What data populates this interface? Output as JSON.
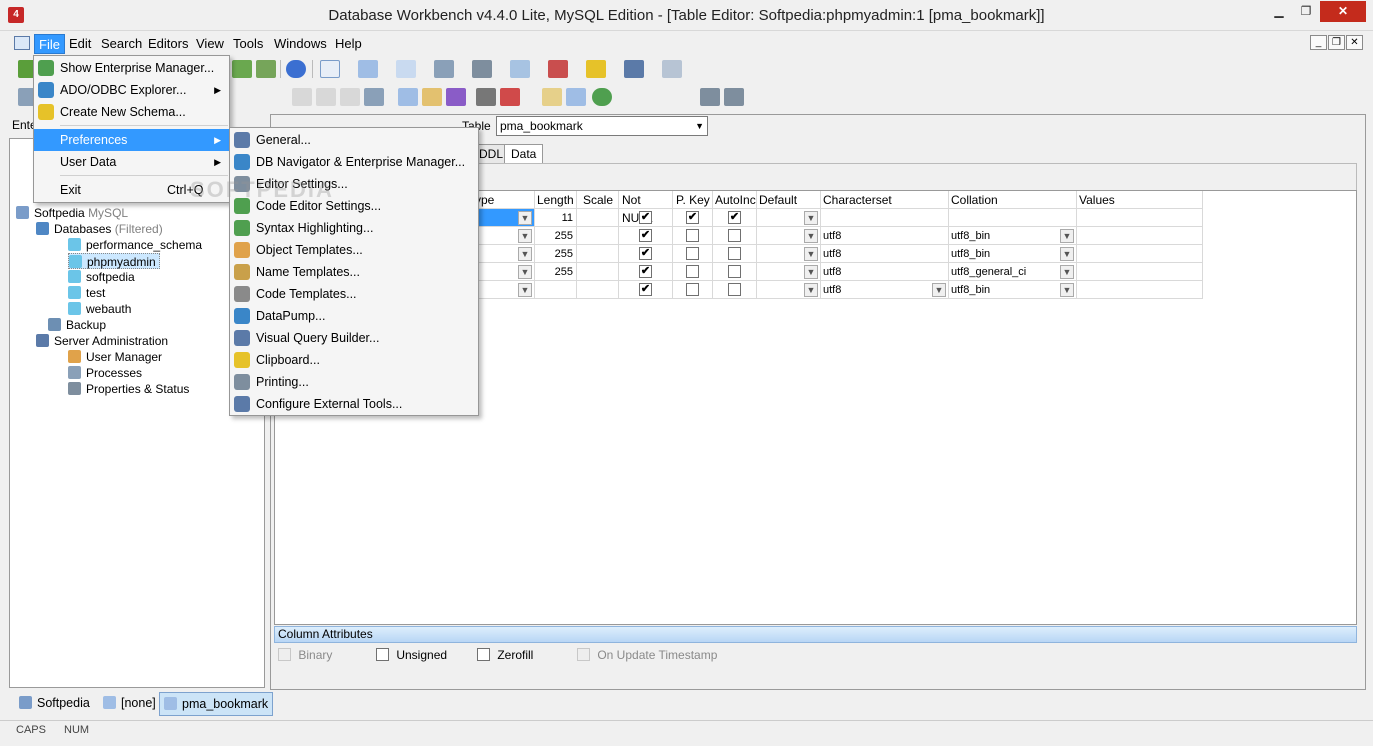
{
  "window": {
    "title": "Database Workbench v4.4.0 Lite, MySQL Edition - [Table Editor: Softpedia:phpmyadmin:1 [pma_bookmark]]",
    "app_icon_text": "4"
  },
  "menubar": {
    "items": [
      "File",
      "Edit",
      "Search",
      "Editors",
      "View",
      "Tools",
      "Windows",
      "Help"
    ]
  },
  "left": {
    "label": "Ente",
    "tree": [
      {
        "label": "Softpedia",
        "extra": "MySQL"
      },
      {
        "label": "Databases",
        "extra": "(Filtered)"
      },
      {
        "label": "performance_schema",
        "extra": ""
      },
      {
        "label": "phpmyadmin",
        "extra": ""
      },
      {
        "label": "softpedia",
        "extra": ""
      },
      {
        "label": "test",
        "extra": ""
      },
      {
        "label": "webauth",
        "extra": ""
      },
      {
        "label": "Backup",
        "extra": ""
      },
      {
        "label": "Server Administration",
        "extra": ""
      },
      {
        "label": "User Manager",
        "extra": ""
      },
      {
        "label": "Processes",
        "extra": ""
      },
      {
        "label": "Properties & Status",
        "extra": ""
      }
    ]
  },
  "editor": {
    "table_label": "Table",
    "table_value": "pma_bookmark",
    "tab_ddl": "DDL",
    "tab_data": "Data",
    "columns": [
      "ype",
      "Length",
      "Scale",
      "Not NULL",
      "P. Key",
      "AutoInc",
      "Default",
      "Characterset",
      "Collation",
      "Values"
    ],
    "rows": [
      {
        "length": "11",
        "notnull": true,
        "pkey": true,
        "autoinc": true,
        "charset": "",
        "collation": ""
      },
      {
        "length": "255",
        "notnull": true,
        "pkey": false,
        "autoinc": false,
        "charset": "utf8",
        "collation": "utf8_bin"
      },
      {
        "length": "255",
        "notnull": true,
        "pkey": false,
        "autoinc": false,
        "charset": "utf8",
        "collation": "utf8_bin"
      },
      {
        "length": "255",
        "notnull": true,
        "pkey": false,
        "autoinc": false,
        "charset": "utf8",
        "collation": "utf8_general_ci"
      },
      {
        "length": "",
        "notnull": true,
        "pkey": false,
        "autoinc": false,
        "charset": "utf8",
        "collation": "utf8_bin"
      }
    ],
    "attributes_title": "Column Attributes",
    "attributes": [
      "Binary",
      "Unsigned",
      "Zerofill",
      "On Update Timestamp"
    ]
  },
  "bottom_tabs": [
    "Softpedia",
    "[none]",
    "pma_bookmark"
  ],
  "status": {
    "caps": "CAPS",
    "num": "NUM"
  },
  "file_menu": {
    "items": [
      {
        "label": "Show Enterprise Manager...",
        "shortcut": "",
        "sub": false
      },
      {
        "label": "ADO/ODBC Explorer...",
        "shortcut": "",
        "sub": true
      },
      {
        "label": "Create New Schema...",
        "shortcut": "",
        "sub": false
      },
      {
        "label": "Preferences",
        "shortcut": "",
        "sub": true
      },
      {
        "label": "User Data",
        "shortcut": "",
        "sub": true
      },
      {
        "label": "Exit",
        "shortcut": "Ctrl+Q",
        "sub": false
      }
    ]
  },
  "prefs_menu": {
    "items": [
      "General...",
      "DB Navigator & Enterprise Manager...",
      "Editor Settings...",
      "Code Editor Settings...",
      "Syntax Highlighting...",
      "Object Templates...",
      "Name Templates...",
      "Code Templates...",
      "DataPump...",
      "Visual Query Builder...",
      "Clipboard...",
      "Printing...",
      "Configure External Tools..."
    ]
  },
  "watermark": "SOFTPEDIA"
}
